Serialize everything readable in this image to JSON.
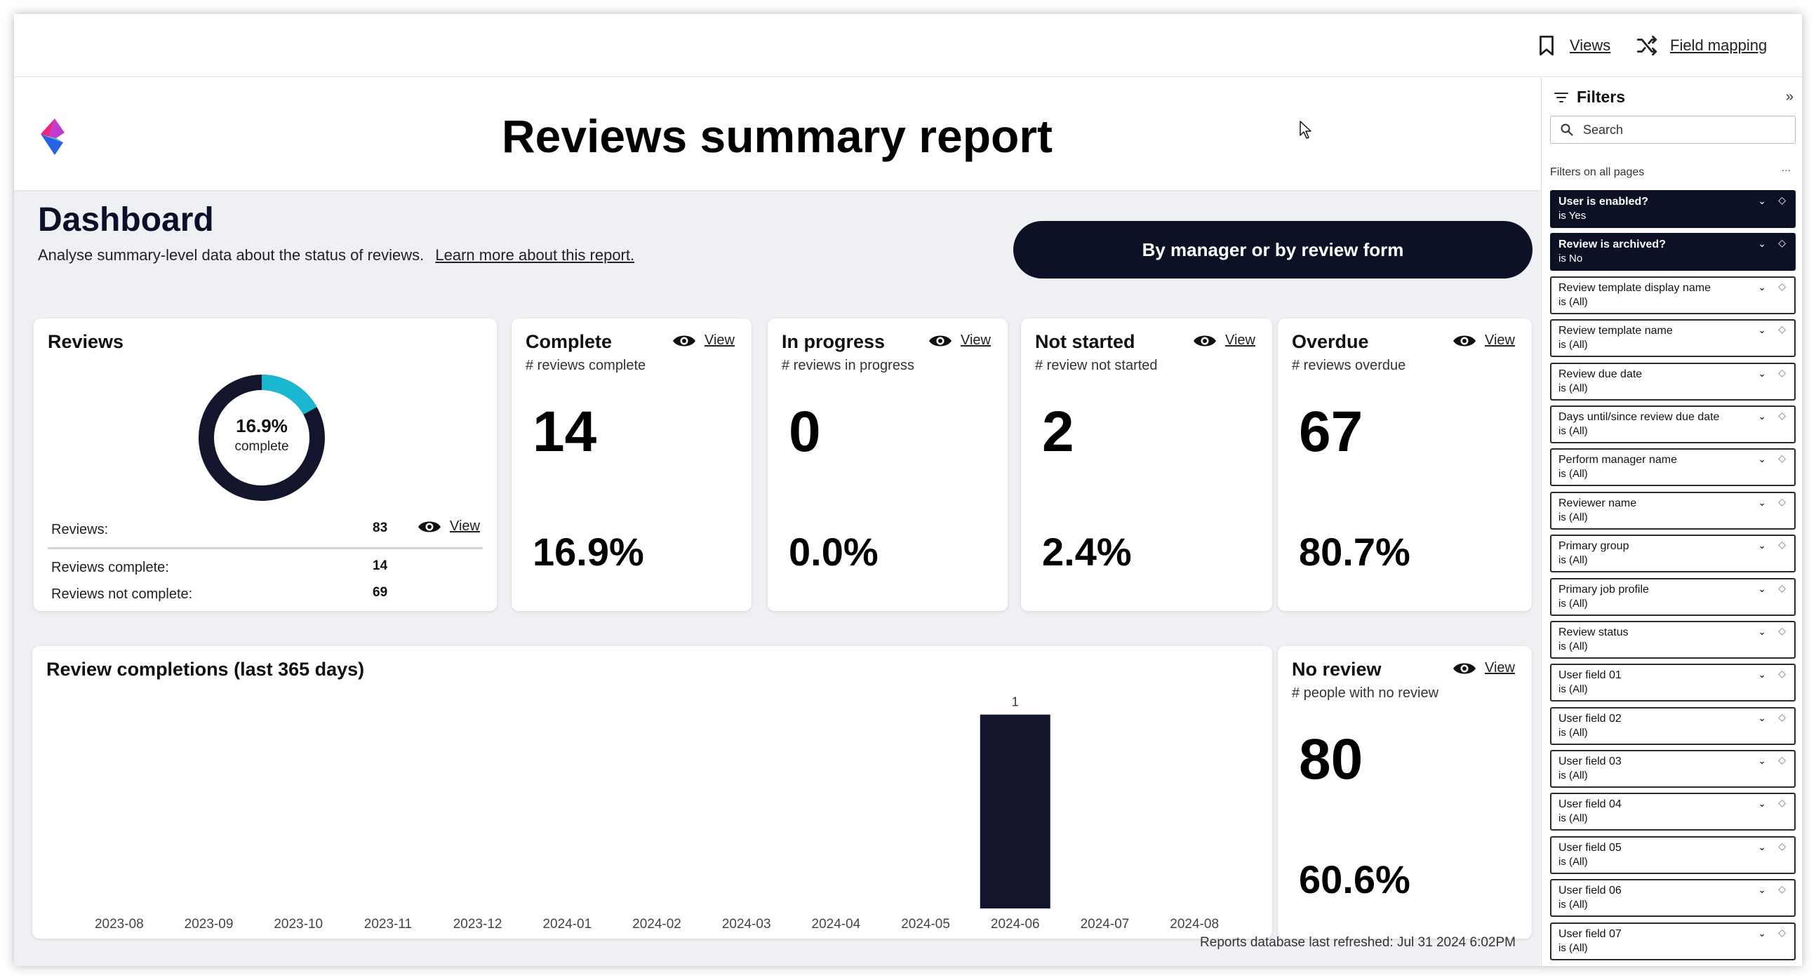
{
  "toolbar": {
    "views_label": "Views",
    "field_mapping_label": "Field mapping"
  },
  "report": {
    "title": "Reviews summary report",
    "dashboard_title": "Dashboard",
    "dashboard_subtitle": "Analyse summary-level data about the status of reviews.",
    "learn_more_link": "Learn more about this report.",
    "manager_button": "By manager or by review form",
    "refreshed_text": "Reports database last refreshed: Jul 31 2024  6:02PM"
  },
  "reviews_card": {
    "title": "Reviews",
    "donut_percent": "16.9%",
    "donut_label": "complete",
    "donut_fraction": 0.169,
    "reviews_label": "Reviews:",
    "reviews_value": "83",
    "complete_label": "Reviews complete:",
    "complete_value": "14",
    "not_complete_label": "Reviews not complete:",
    "not_complete_value": "69",
    "view_label": "View"
  },
  "kpis": [
    {
      "title": "Complete",
      "subtitle": "# reviews complete",
      "value": "14",
      "percent": "16.9%",
      "view_label": "View"
    },
    {
      "title": "In progress",
      "subtitle": "# reviews in progress",
      "value": "0",
      "percent": "0.0%",
      "view_label": "View"
    },
    {
      "title": "Not started",
      "subtitle": "# review not started",
      "value": "2",
      "percent": "2.4%",
      "view_label": "View"
    },
    {
      "title": "Overdue",
      "subtitle": "# reviews overdue",
      "value": "67",
      "percent": "80.7%",
      "view_label": "View"
    }
  ],
  "no_review": {
    "title": "No review",
    "subtitle": "# people with no review",
    "value": "80",
    "percent": "60.6%",
    "view_label": "View"
  },
  "chart_data": {
    "type": "bar",
    "title": "Review completions (last 365 days)",
    "categories": [
      "2023-08",
      "2023-09",
      "2023-10",
      "2023-11",
      "2023-12",
      "2024-01",
      "2024-02",
      "2024-03",
      "2024-04",
      "2024-05",
      "2024-06",
      "2024-07",
      "2024-08"
    ],
    "values": [
      0,
      0,
      0,
      0,
      0,
      0,
      0,
      0,
      0,
      0,
      1,
      0,
      0
    ],
    "data_labels": [
      "",
      "",
      "",
      "",
      "",
      "",
      "",
      "",
      "",
      "",
      "1",
      "",
      ""
    ],
    "ylim": [
      0,
      1.1
    ],
    "grid": false,
    "bar_color": "#12152b"
  },
  "filters": {
    "title": "Filters",
    "search_placeholder": "Search",
    "scope_label": "Filters on all pages",
    "more_label": "...",
    "collapse_label": "»",
    "items": [
      {
        "name": "User is enabled?",
        "value": "is Yes",
        "active": true
      },
      {
        "name": "Review is archived?",
        "value": "is No",
        "active": true
      },
      {
        "name": "Review template display name",
        "value": "is (All)",
        "active": false
      },
      {
        "name": "Review template name",
        "value": "is (All)",
        "active": false
      },
      {
        "name": "Review due date",
        "value": "is (All)",
        "active": false
      },
      {
        "name": "Days until/since review due date",
        "value": "is (All)",
        "active": false
      },
      {
        "name": "Perform manager name",
        "value": "is (All)",
        "active": false
      },
      {
        "name": "Reviewer name",
        "value": "is (All)",
        "active": false
      },
      {
        "name": "Primary group",
        "value": "is (All)",
        "active": false
      },
      {
        "name": "Primary job profile",
        "value": "is (All)",
        "active": false
      },
      {
        "name": "Review status",
        "value": "is (All)",
        "active": false
      },
      {
        "name": "User field 01",
        "value": "is (All)",
        "active": false
      },
      {
        "name": "User field 02",
        "value": "is (All)",
        "active": false
      },
      {
        "name": "User field 03",
        "value": "is (All)",
        "active": false
      },
      {
        "name": "User field 04",
        "value": "is (All)",
        "active": false
      },
      {
        "name": "User field 05",
        "value": "is (All)",
        "active": false
      },
      {
        "name": "User field 06",
        "value": "is (All)",
        "active": false
      },
      {
        "name": "User field 07",
        "value": "is (All)",
        "active": false
      }
    ]
  },
  "colors": {
    "navy": "#0d1126",
    "accent_teal": "#1ab7d0",
    "donut_dark": "#12152b",
    "logo_pink": "#e8277f",
    "logo_blue": "#2a63e0",
    "logo_cyan": "#23b9e0"
  }
}
